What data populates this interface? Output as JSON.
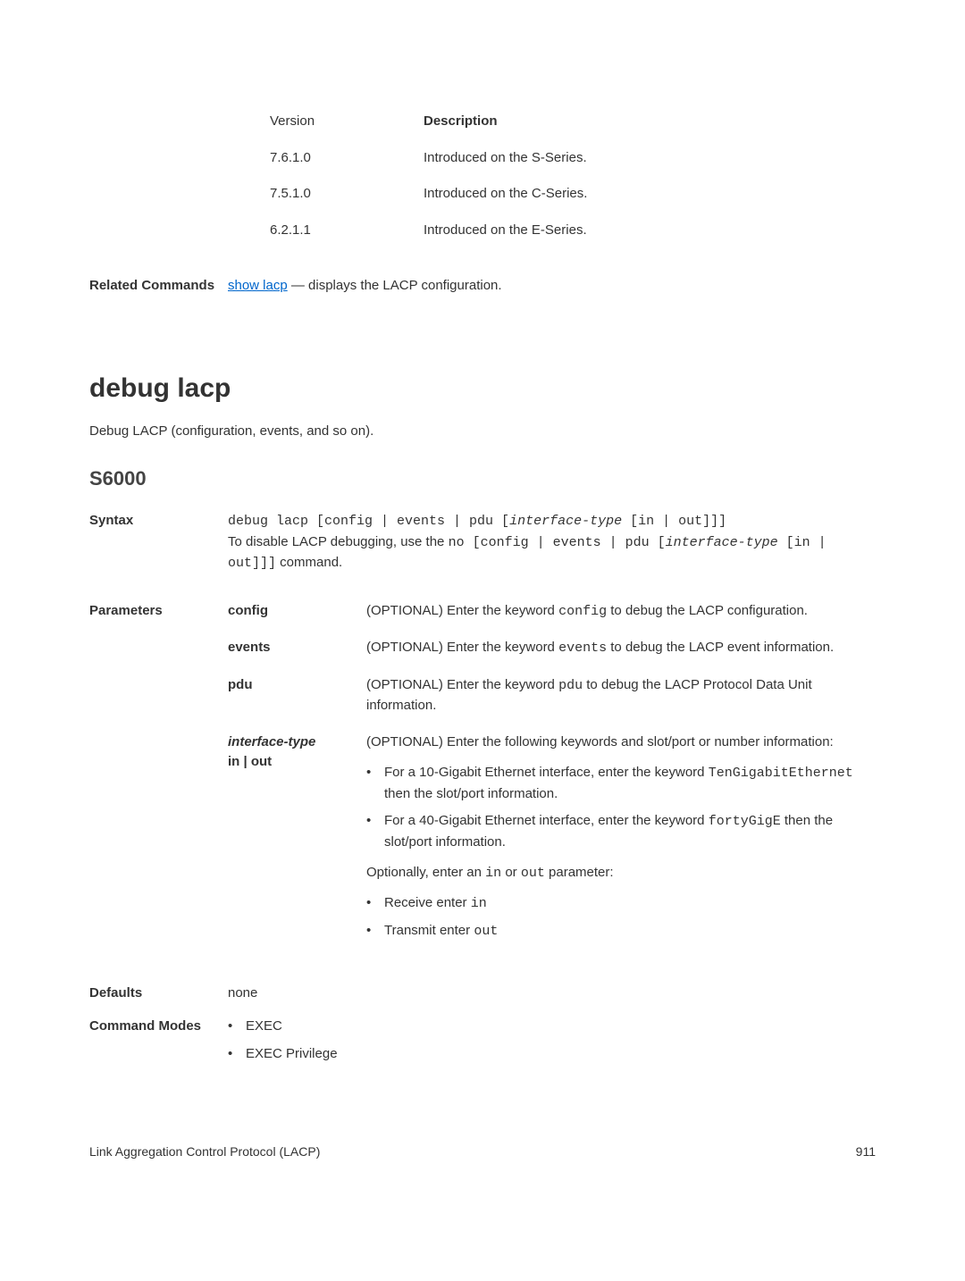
{
  "version_table": {
    "header": {
      "version": "Version",
      "description": "Description"
    },
    "rows": [
      {
        "version": "7.6.1.0",
        "description": "Introduced on the S-Series."
      },
      {
        "version": "7.5.1.0",
        "description": "Introduced on the C-Series."
      },
      {
        "version": "6.2.1.1",
        "description": "Introduced on the E-Series."
      }
    ]
  },
  "related": {
    "label": "Related Commands",
    "link_text": "show lacp",
    "rest": " — displays the LACP configuration."
  },
  "command": {
    "title": "debug lacp",
    "desc": "Debug LACP (configuration, events, and so on).",
    "model": "S6000"
  },
  "syntax": {
    "label": "Syntax",
    "line1_pre": "debug lacp [config | events | pdu [",
    "line1_it": "interface-type",
    "line1_post": " [in | out]]]",
    "line2_pre": "To disable LACP debugging, use the ",
    "line2_code": "no [config | events | pdu [",
    "line2_it": "interface-type",
    "line2_code2": " [in | out]]]",
    "line2_post": " command."
  },
  "parameters": {
    "label": "Parameters",
    "items": [
      {
        "name": "config",
        "desc_pre": "(OPTIONAL) Enter the keyword ",
        "code": "config",
        "desc_post": " to debug the LACP configuration."
      },
      {
        "name": "events",
        "desc_pre": "(OPTIONAL) Enter the keyword ",
        "code": "events",
        "desc_post": " to debug the LACP event information."
      },
      {
        "name": "pdu",
        "desc_pre": "(OPTIONAL) Enter the keyword ",
        "code": "pdu",
        "desc_post": " to debug the LACP Protocol Data Unit information."
      }
    ],
    "interface": {
      "name": "interface-type in | out",
      "desc": "(OPTIONAL) Enter the following keywords and slot/port or number information:",
      "bullets": [
        {
          "lead": "For a 10-Gigabit Ethernet interface, enter the keyword ",
          "code": "TenGigabitEthernet",
          "tail": " then the slot/port information."
        },
        {
          "lead": "For a 40-Gigabit Ethernet interface, enter the keyword ",
          "code": "fortyGigE",
          "tail": " then the slot/port information."
        }
      ],
      "optional_text": "Optionally, enter an ",
      "optional_code1": "in",
      "optional_mid": " or ",
      "optional_code2": "out",
      "optional_end": " parameter:",
      "opt_bullets": [
        {
          "lead": "Receive enter ",
          "code": "in"
        },
        {
          "lead": "Transmit enter ",
          "code": "out"
        }
      ]
    }
  },
  "defaults": {
    "label": "Defaults",
    "value": "none"
  },
  "modes": {
    "label": "Command Modes",
    "items": [
      "EXEC",
      "EXEC Privilege"
    ]
  },
  "footer": {
    "left": "Link Aggregation Control Protocol (LACP)",
    "right": "911"
  }
}
